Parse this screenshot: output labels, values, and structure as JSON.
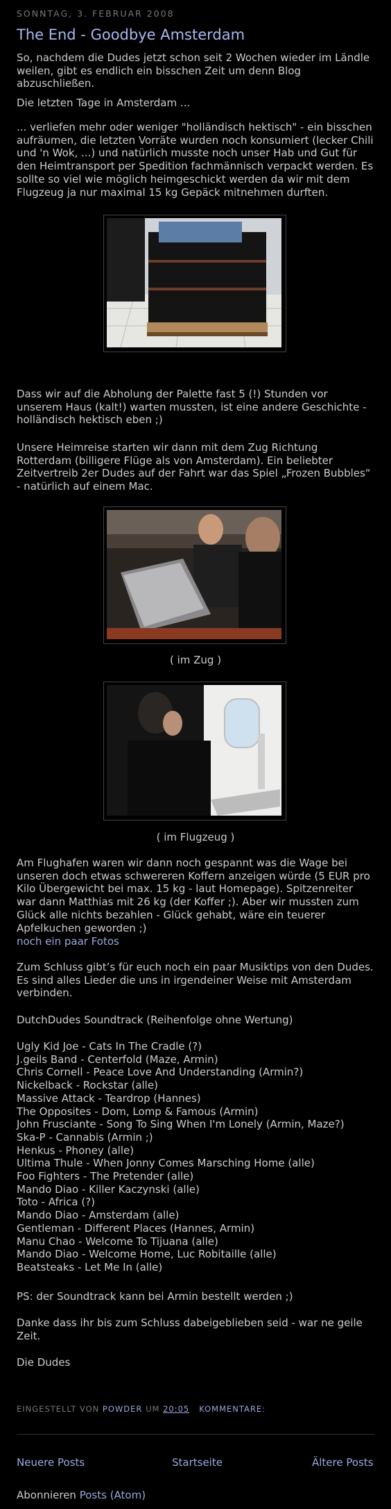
{
  "post": {
    "date": "Sonntag, 3. Februar 2008",
    "title": "The End - Goodbye Amsterdam",
    "para1": "So, nachdem die Dudes jetzt schon seit 2 Wochen wieder im Ländle weilen, gibt es endlich ein bisschen Zeit um denn Blog abzuschließen.",
    "para2": "Die letzten Tage in Amsterdam ...",
    "para3": "... verliefen mehr oder weniger \"holländisch hektisch\" - ein bisschen aufräumen, die letzten Vorräte wurden noch konsumiert (lecker Chili und 'n Wok, ...) und natürlich musste noch unser Hab und Gut für den Heimtransport per Spedition fachmännisch verpackt werden. Es sollte so viel wie möglich heimgeschickt werden da wir mit dem Flugzeug ja nur maximal 15 kg Gepäck mitnehmen durften.",
    "para4": "Dass wir auf die Abholung der Palette fast 5 (!) Stunden vor unserem Haus (kalt!) warten mussten, ist eine andere Geschichte - holländisch hektisch eben ;)",
    "para5": "Unsere Heimreise starten wir dann mit dem Zug Richtung Rotterdam (billigere Flüge als von Amsterdam). Ein beliebter Zeitvertreib 2er Dudes auf der Fahrt war das Spiel „Frozen Bubbles“ - natürlich auf einem Mac.",
    "caption_train": "( im Zug )",
    "caption_plane": "( im Flugzeug )",
    "para6": "Am Flughafen waren wir dann noch gespannt was die Wage bei unseren doch etwas schwereren Koffern anzeigen würde (5 EUR pro Kilo Übergewicht bei max. 15 kg - laut Homepage). Spitzenreiter war dann Matthias mit 26 kg (der Koffer ;). Aber wir mussten zum Glück alle nichts bezahlen - Glück gehabt, wäre ein teuerer Apfelkuchen geworden ;)",
    "photos_link": "noch ein paar Fotos",
    "para7": "Zum Schluss gibt’s für euch noch ein paar Musiktips von den Dudes. Es sind alles Lieder die uns in irgendeiner Weise mit Amsterdam verbinden.",
    "soundtrack_title": "DutchDudes Soundtrack (Reihenfolge ohne Wertung)",
    "tracks": [
      "Ugly Kid Joe - Cats In The Cradle (?)",
      "J.geils Band - Centerfold (Maze, Armin)",
      "Chris Cornell - Peace Love And Understanding (Armin?)",
      "Nickelback - Rockstar (alle)",
      "Massive Attack - Teardrop (Hannes)",
      "The Opposites - Dom, Lomp & Famous (Armin)",
      "John Frusciante - Song To Sing When I'm Lonely (Armin, Maze?)",
      "Ska-P - Cannabis (Armin ;)",
      "Henkus - Phoney (alle)",
      "Ultima Thule - When Jonny Comes Marsching Home (alle)",
      "Foo Fighters - The Pretender (alle)",
      "Mando Diao - Killer Kaczynski (alle)",
      "Toto - Africa (?)",
      "Mando Diao - Amsterdam (alle)",
      "Gentleman - Different Places (Hannes, Armin)",
      "Manu Chao - Welcome To Tijuana (alle)",
      "Mando Diao - Welcome Home, Luc Robitaille (alle)",
      "Beatsteaks - Let Me In (alle)"
    ],
    "ps": "PS: der Soundtrack kann bei Armin bestellt werden ;)",
    "thanks": "Danke dass ihr bis zum Schluss dabeigeblieben seid - war ne geile Zeit.",
    "signature": "Die Dudes"
  },
  "footer": {
    "posted_by": "Eingestellt von",
    "author": "Powder",
    "at": "um",
    "time": "20:05",
    "comments": "Kommentare:"
  },
  "nav": {
    "newer": "Neuere Posts",
    "home": "Startseite",
    "older": "Ältere Posts"
  },
  "subscribe": {
    "label": "Abonnieren",
    "link": "Posts (Atom)"
  },
  "colors": {
    "background": "#000000",
    "text": "#cccccc",
    "title": "#aab8f0",
    "link": "#99aadd",
    "muted": "#777777"
  }
}
